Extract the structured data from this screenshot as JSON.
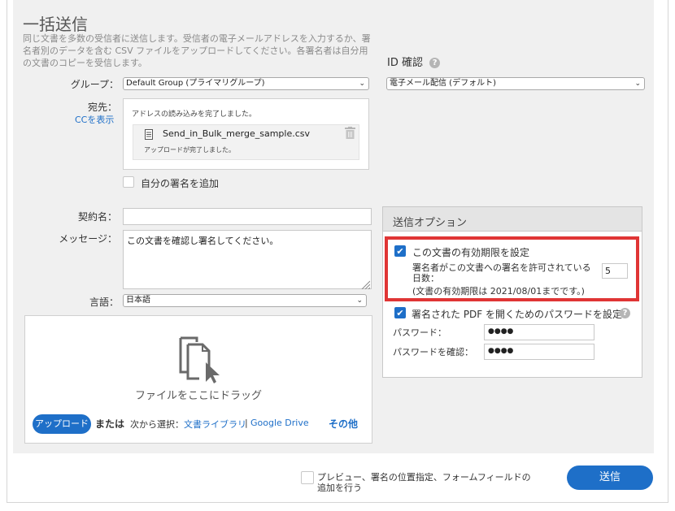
{
  "header": {
    "title": "一括送信",
    "description": "同じ文書を多数の受信者に送信します。受信者の電子メールアドレスを入力するか、署名者別のデータを含む CSV ファイルをアップロードしてください。各署名者は自分用の文書のコピーを受信します。"
  },
  "id_check": {
    "label": "ID 確認",
    "selected": "電子メール配信 (デフォルト)"
  },
  "group": {
    "label": "グループ：",
    "selected": "Default Group (プライマリグループ)"
  },
  "recipient": {
    "label": "宛先：",
    "cc_link": "CCを表示",
    "load_status": "アドレスの読み込みを完了しました。",
    "file_name": "Send_in_Bulk_merge_sample.csv",
    "file_status": "アップロードが完了しました。"
  },
  "add_own_signature": {
    "label": "自分の署名を追加"
  },
  "agreement_name": {
    "label": "契約名：",
    "value": ""
  },
  "message": {
    "label": "メッセージ：",
    "value": "この文書を確認し署名してください。"
  },
  "language": {
    "label": "言語：",
    "selected": "日本語"
  },
  "dropzone": {
    "drag_text": "ファイルをここにドラッグ",
    "upload_button": "アップロード",
    "or_text": "または",
    "select_from": "次から選択：",
    "doc_library": "文書ライブラリ",
    "separator": "|",
    "google_drive": "Google Drive",
    "more": "その他"
  },
  "send_options": {
    "title": "送信オプション",
    "expiry_check_label": "この文書の有効期限を設定",
    "expiry_days_label": "署名者がこの文書への署名を許可されている日数：",
    "expiry_days_value": "5",
    "expiry_note": "(文書の有効期限は 2021/08/01までです。)",
    "password_check_label": "署名された PDF を開くためのパスワードを設定",
    "password_label": "パスワード：",
    "password_value": "●●●●",
    "password_confirm_label": "パスワードを確認：",
    "password_confirm_value": "●●●●"
  },
  "footer": {
    "preview_label_line1": "プレビュー、署名の位置指定、フォームフィールドの",
    "preview_label_line2": "追加を行う",
    "send_button": "送信"
  },
  "colors": {
    "accent": "#1e6fc8",
    "highlight": "#e03535",
    "panel": "#f0f0f0"
  }
}
